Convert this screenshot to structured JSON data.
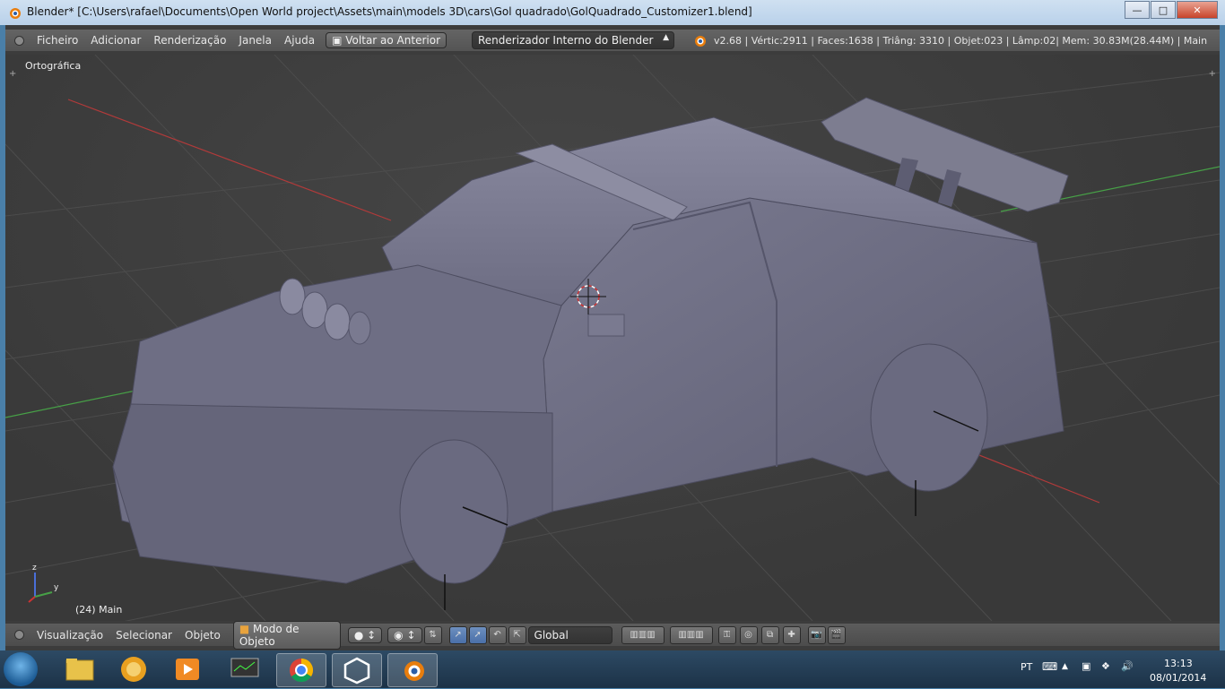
{
  "window": {
    "title": "Blender* [C:\\Users\\rafael\\Documents\\Open World project\\Assets\\main\\models 3D\\cars\\Gol quadrado\\GolQuadrado_Customizer1.blend]"
  },
  "header": {
    "menus": [
      "Ficheiro",
      "Adicionar",
      "Renderização",
      "Janela",
      "Ajuda"
    ],
    "back_button": "Voltar ao Anterior",
    "render_engine": "Renderizador Interno do Blender",
    "stats": "v2.68 | Vértic:2911 | Faces:1638 | Triâng: 3310 | Objet:023 | Lâmp:02| Mem: 30.83M(28.44M) | Main"
  },
  "viewport": {
    "view_label": "Ortográfica",
    "frame_label": "(24) Main",
    "axis_z": "z",
    "axis_y": "y"
  },
  "footer": {
    "menus": [
      "Visualização",
      "Selecionar",
      "Objeto"
    ],
    "mode": "Modo de Objeto",
    "orientation": "Global"
  },
  "taskbar": {
    "language": "PT",
    "time": "13:13",
    "date": "08/01/2014",
    "apps": [
      "explorer-icon",
      "lion-app-icon",
      "media-player-icon",
      "monitor-app-icon",
      "chrome-icon",
      "unity-icon",
      "blender-icon"
    ]
  },
  "colors": {
    "accent_orange": "#e87d0d",
    "x_axis": "#c23b3b",
    "y_axis": "#4caf50",
    "car_body": "#6e6e86"
  }
}
